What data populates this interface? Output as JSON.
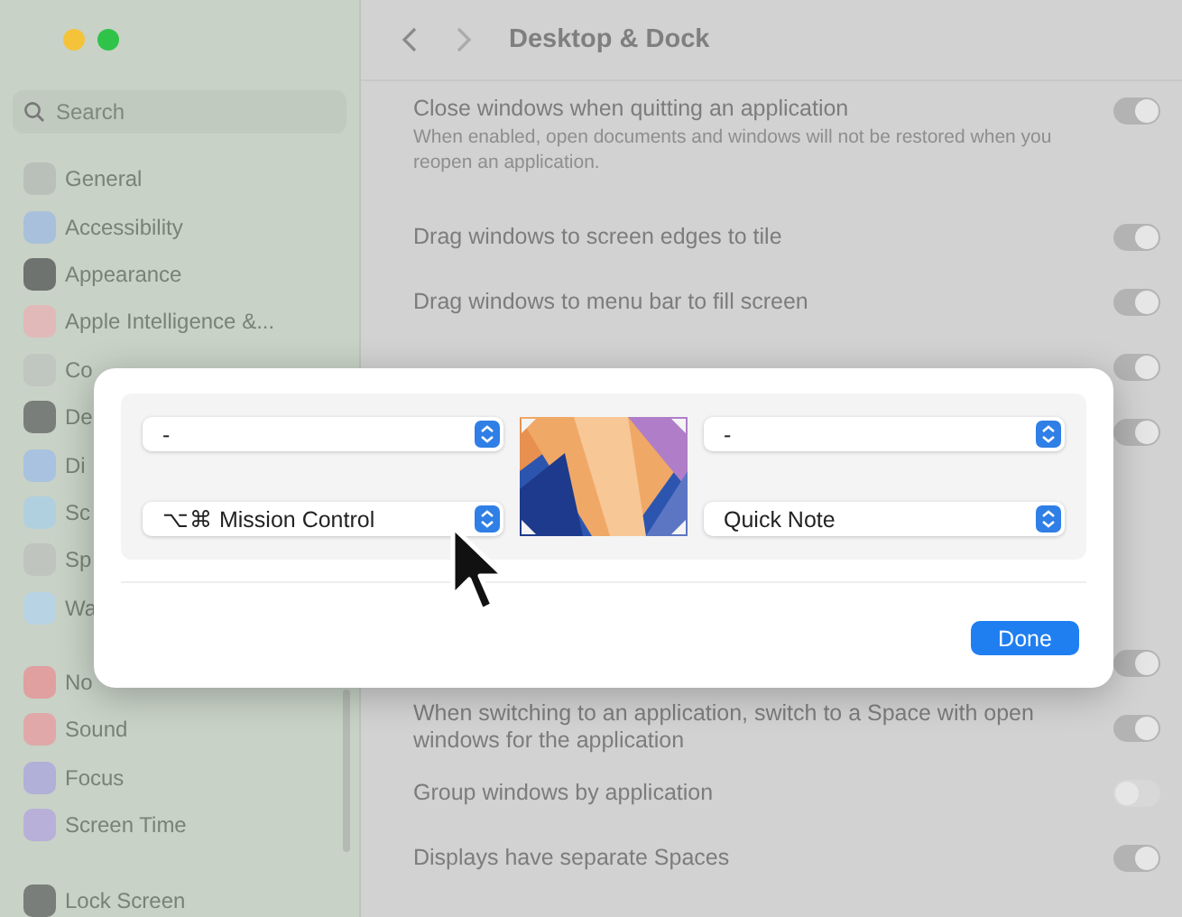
{
  "window": {
    "title": "Desktop & Dock"
  },
  "sidebar": {
    "search": {
      "placeholder": "Search"
    },
    "groups": [
      [
        {
          "label": "General",
          "color": "#b9bfb9"
        },
        {
          "label": "Accessibility",
          "color": "#a9c0dc"
        },
        {
          "label": "Appearance",
          "color": "#6f736f"
        },
        {
          "label": "Apple Intelligence &...",
          "color": "#e2b9b9"
        },
        {
          "label": "Co",
          "color": "#c0c6c0"
        },
        {
          "label": "De",
          "color": "#7a7e7a"
        },
        {
          "label": "Di",
          "color": "#a8c2e0"
        },
        {
          "label": "Sc",
          "color": "#b0d0e0"
        },
        {
          "label": "Sp",
          "color": "#bfc4bf"
        },
        {
          "label": "Wa",
          "color": "#b8d4e4"
        }
      ],
      [
        {
          "label": "No",
          "color": "#e0a0a0"
        },
        {
          "label": "Sound",
          "color": "#e0a8a8"
        },
        {
          "label": "Focus",
          "color": "#b0b0d8"
        },
        {
          "label": "Screen Time",
          "color": "#b8b0d8"
        }
      ],
      [
        {
          "label": "Lock Screen",
          "color": "#7a7e7a"
        }
      ]
    ]
  },
  "settings": [
    {
      "kind": "toggle",
      "label": "Close windows when quitting an application",
      "description": "When enabled, open documents and windows will not be restored when you reopen an application.",
      "on": true
    },
    {
      "kind": "toggle",
      "label": "Drag windows to screen edges to tile",
      "on": true
    },
    {
      "kind": "toggle",
      "label": "Drag windows to menu bar to fill screen",
      "on": true
    },
    {
      "kind": "covered",
      "on": true
    },
    {
      "kind": "covered",
      "on": true
    },
    {
      "kind": "covered_tall"
    },
    {
      "kind": "covered",
      "on": true
    },
    {
      "kind": "toggle",
      "label": "When switching to an application, switch to a Space with open windows for the application",
      "on": true
    },
    {
      "kind": "toggle",
      "label": "Group windows by application",
      "on": false
    },
    {
      "kind": "toggle",
      "label": "Displays have separate Spaces",
      "on": true
    }
  ],
  "hot_corners_dialog": {
    "corners": [
      {
        "value": "-"
      },
      {
        "value": "-"
      },
      {
        "value": "⌥⌘ Mission Control"
      },
      {
        "value": "Quick Note"
      }
    ],
    "button": "Done"
  }
}
